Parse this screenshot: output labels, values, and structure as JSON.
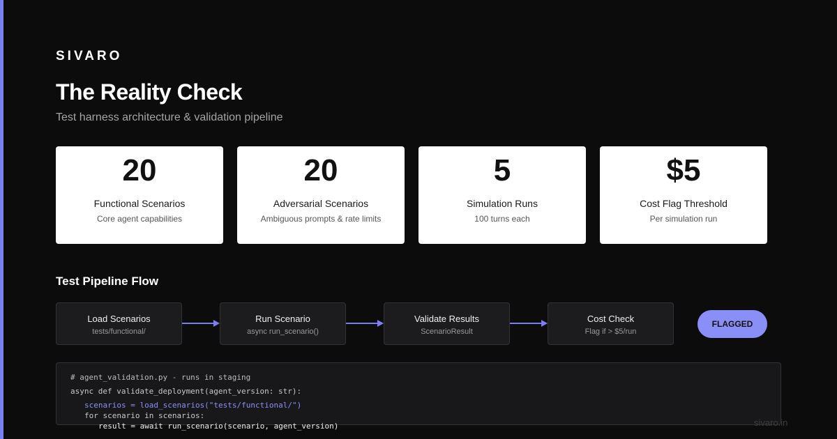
{
  "brand": "SIVARO",
  "title": "The Reality Check",
  "subtitle": "Test harness architecture & validation pipeline",
  "stats": [
    {
      "value": "20",
      "label": "Functional Scenarios",
      "sub": "Core agent capabilities"
    },
    {
      "value": "20",
      "label": "Adversarial Scenarios",
      "sub": "Ambiguous prompts & rate limits"
    },
    {
      "value": "5",
      "label": "Simulation Runs",
      "sub": "100 turns each"
    },
    {
      "value": "$5",
      "label": "Cost Flag Threshold",
      "sub": "Per simulation run"
    }
  ],
  "pipeline": {
    "title": "Test Pipeline Flow",
    "steps": [
      {
        "label": "Load Scenarios",
        "sub": "tests/functional/"
      },
      {
        "label": "Run Scenario",
        "sub": "async run_scenario()"
      },
      {
        "label": "Validate Results",
        "sub": "ScenarioResult"
      },
      {
        "label": "Cost Check",
        "sub": "Flag if > $5/run"
      }
    ],
    "badge": "FLAGGED"
  },
  "code": {
    "lines": [
      "# agent_validation.py - runs in staging",
      "async def validate_deployment(agent_version: str):",
      "scenarios = load_scenarios(\"tests/functional/\")",
      "for scenario in scenarios:",
      "result = await run_scenario(scenario, agent_version)"
    ]
  },
  "footer": "sivaro.in",
  "colors": {
    "accent": "#7b7ff2",
    "badge": "#8a8ef7",
    "background": "#0c0c0c",
    "card": "#ffffff"
  }
}
